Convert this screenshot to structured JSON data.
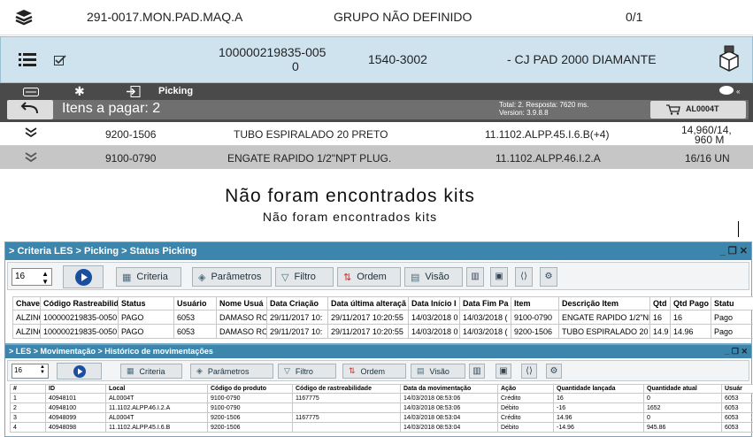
{
  "row1": {
    "icon": "layers-icon",
    "code": "291-0017.MON.PAD.MAQ.A",
    "group": "GRUPO NÃO DEFINIDO",
    "count": "0/1"
  },
  "row2": {
    "id_line1": "100000219835-005",
    "id_line2": "0",
    "code": "1540-3002",
    "desc": "- CJ PAD 2000 DIAMANTE"
  },
  "toolbar": {
    "picking_label": "Picking",
    "itens_label": "Itens a pagar: 2",
    "total_line1": "Total: 2. Resposta: 7620 ms.",
    "total_line2": "Version: 3.9.8.8",
    "cart_label": "AL0004T"
  },
  "list": [
    {
      "code": "9200-1506",
      "desc": "TUBO ESPIRALADO 20 PRETO",
      "loc": "11.1102.ALPP.45.I.6.B(+4)",
      "qty1": "14,960/14,",
      "qty2": "960 M"
    },
    {
      "code": "9100-0790",
      "desc": "ENGATE RAPIDO 1/2\"NPT PLUG.",
      "loc": "11.1102.ALPP.46.I.2.A",
      "qty1": "16/16 UN",
      "qty2": ""
    }
  ],
  "kits": {
    "title": "Não foram encontrados kits",
    "subtitle": "Não foram encontrados kits"
  },
  "win1": {
    "title": "> Criteria LES > Picking > Status Picking",
    "page_size": "16",
    "buttons": {
      "criteria": "Criteria",
      "parametros": "Parâmetros",
      "filtro": "Filtro",
      "ordem": "Ordem",
      "visao": "Visão"
    },
    "headers": [
      "Chave",
      "Código Rastreabilid",
      "Status",
      "Usuário",
      "Nome Usuá",
      "Data Criação",
      "Data última alteraçã",
      "Data Início I",
      "Data Fim Pa",
      "Item",
      "Descrição Item",
      "Qtd",
      "Qtd Pago",
      "Statu"
    ],
    "rows": [
      [
        "ALZINC",
        "100000219835-0050",
        "PAGO",
        "6053",
        "DAMASO ROI",
        "29/11/2017 10:",
        "29/11/2017 10:20:55",
        "14/03/2018 0",
        "14/03/2018 (",
        "9100-0790",
        "ENGATE RAPIDO 1/2\"NP",
        "16",
        "16",
        "Pago"
      ],
      [
        "ALZINC",
        "100000219835-0050",
        "PAGO",
        "6053",
        "DAMASO ROI",
        "29/11/2017 10:",
        "29/11/2017 10:20:55",
        "14/03/2018 0",
        "14/03/2018 (",
        "9200-1506",
        "TUBO ESPIRALADO 20 P",
        "14.9",
        "14.96",
        "Pago"
      ]
    ]
  },
  "win2": {
    "title": "> LES > Movimentação > Histórico de movimentações",
    "page_size": "16",
    "buttons": {
      "criteria": "Criteria",
      "parametros": "Parâmetros",
      "filtro": "Filtro",
      "ordem": "Ordem",
      "visao": "Visão"
    },
    "headers": [
      "#",
      "ID",
      "Local",
      "Código do produto",
      "Código de rastreabilidade",
      "Data da movimentação",
      "Ação",
      "Quantidade lançada",
      "Quantidade atual",
      "Usuár"
    ],
    "rows": [
      [
        "1",
        "40948101",
        "AL0004T",
        "9100-0790",
        "1167775",
        "14/03/2018 08:53:06",
        "Crédito",
        "16",
        "0",
        "6053"
      ],
      [
        "2",
        "40948100",
        "11.1102.ALPP.46.I.2.A",
        "9100-0790",
        "",
        "14/03/2018 08:53:06",
        "Débito",
        "-16",
        "1652",
        "6053"
      ],
      [
        "3",
        "40948099",
        "AL0004T",
        "9200-1506",
        "1167775",
        "14/03/2018 08:53:04",
        "Crédito",
        "14.96",
        "0",
        "6053"
      ],
      [
        "4",
        "40948098",
        "11.1102.ALPP.45.I.6.B",
        "9200-1506",
        "",
        "14/03/2018 08:53:04",
        "Débito",
        "-14.96",
        "945.86",
        "6053"
      ]
    ]
  }
}
